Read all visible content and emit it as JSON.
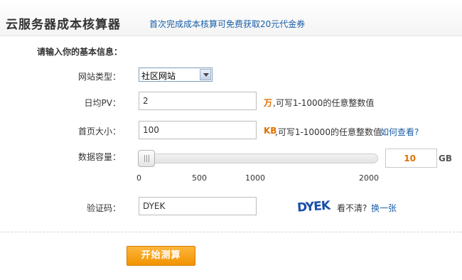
{
  "header": {
    "title": "云服务器成本核算器",
    "promo": "首次完成成本核算可免费获取20元代金券"
  },
  "form": {
    "section_title": "请输入你的基本信息：",
    "site_type": {
      "label": "网站类型：",
      "value": "社区网站"
    },
    "daily_pv": {
      "label": "日均PV：",
      "value": "2",
      "unit": "万",
      "hint": ",可写1-1000的任意整数值"
    },
    "page_size": {
      "label": "首页大小：",
      "value": "100",
      "unit": "KB",
      "hint": ",可写1-10000的任意整数值",
      "link": "如何查看?"
    },
    "storage": {
      "label": "数据容量：",
      "value": "10",
      "unit": "GB",
      "ticks": [
        "0",
        "500",
        "1000",
        "2000"
      ],
      "slider_level": 0.005
    },
    "captcha": {
      "label": "验证码：",
      "value": "DYEK",
      "image_text": "DYEK",
      "unclear": "看不清?",
      "refresh": "换一张"
    }
  },
  "actions": {
    "start": "开始测算"
  },
  "colors": {
    "accent_orange": "#e07000",
    "link_blue": "#1a5fa8",
    "button_orange": "#f29300",
    "captcha_blue": "#1a4fa8"
  }
}
